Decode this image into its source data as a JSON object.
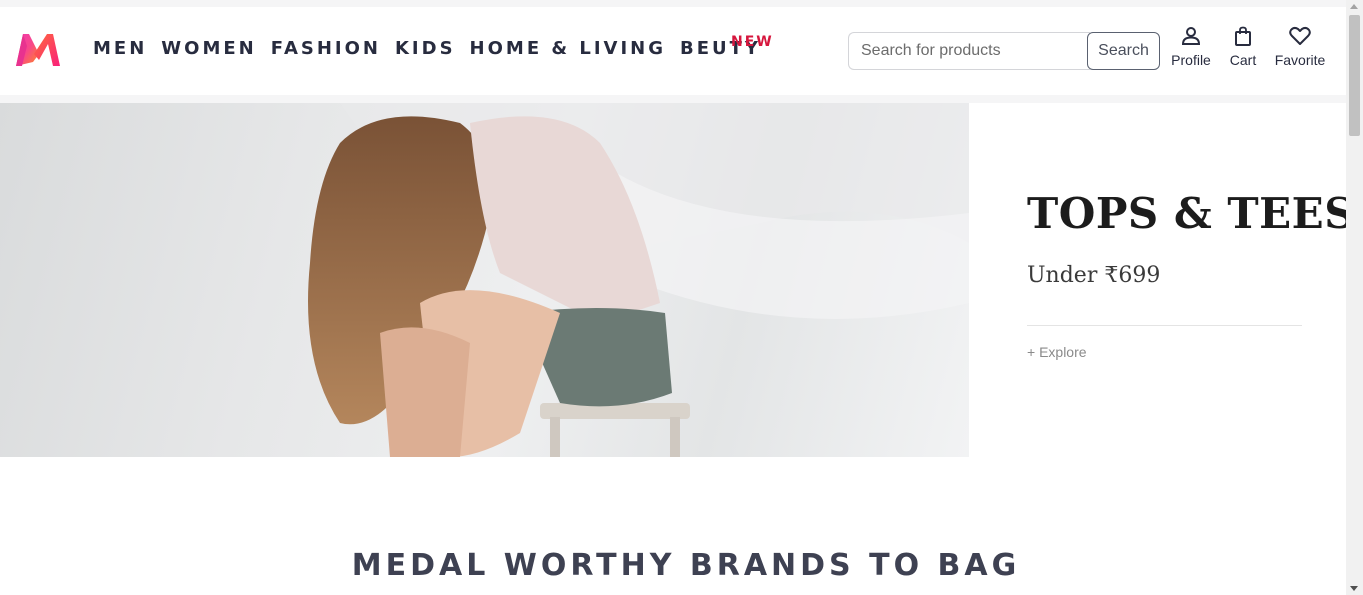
{
  "nav": {
    "items": [
      {
        "label": "MEN"
      },
      {
        "label": "WOMEN"
      },
      {
        "label": "FASHION"
      },
      {
        "label": "KIDS"
      },
      {
        "label": "HOME & LIVING"
      },
      {
        "label": "BEUTY"
      }
    ],
    "new_badge": "NEW"
  },
  "search": {
    "placeholder": "Search for products",
    "button_label": "Search"
  },
  "actions": {
    "profile": "Profile",
    "cart": "Cart",
    "favorite": "Favorite"
  },
  "hero": {
    "title": "TOPS & TEES",
    "subtitle": "Under ₹699",
    "explore": "+ Explore"
  },
  "section": {
    "title": "MEDAL WORTHY BRANDS TO BAG"
  },
  "icons": {
    "logo": "myntra-logo",
    "profile": "person-icon",
    "cart": "shopping-bag-icon",
    "favorite": "heart-icon"
  },
  "colors": {
    "brand_pink": "#ff3f6c",
    "new_badge": "#d6163d",
    "nav_text": "#282c3f"
  }
}
